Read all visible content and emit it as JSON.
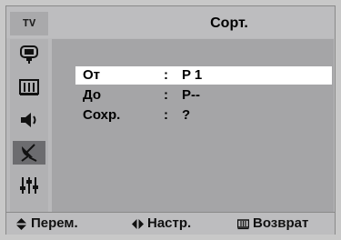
{
  "header": {
    "source_label": "TV",
    "title": "Сорт."
  },
  "sidebar": {
    "items": [
      {
        "icon": "picture-icon",
        "active": false
      },
      {
        "icon": "grid-screen-icon",
        "active": false
      },
      {
        "icon": "speaker-icon",
        "active": false
      },
      {
        "icon": "satellite-antenna-icon",
        "active": true
      },
      {
        "icon": "settings-sliders-icon",
        "active": false
      }
    ]
  },
  "menu": {
    "rows": [
      {
        "label": "От",
        "colon": ":",
        "value": "P 1",
        "selected": true
      },
      {
        "label": "До",
        "colon": ":",
        "value": "P--",
        "selected": false
      },
      {
        "label": "Сохр.",
        "colon": ":",
        "value": "?",
        "selected": false
      }
    ]
  },
  "footer": {
    "move_label": "Перем.",
    "adjust_label": "Настр.",
    "return_label": "Возврат"
  },
  "colors": {
    "osd_bg": "#b9b9bb",
    "selected_row": "#ffffff",
    "active_sidebar": "#6c6c6f"
  }
}
